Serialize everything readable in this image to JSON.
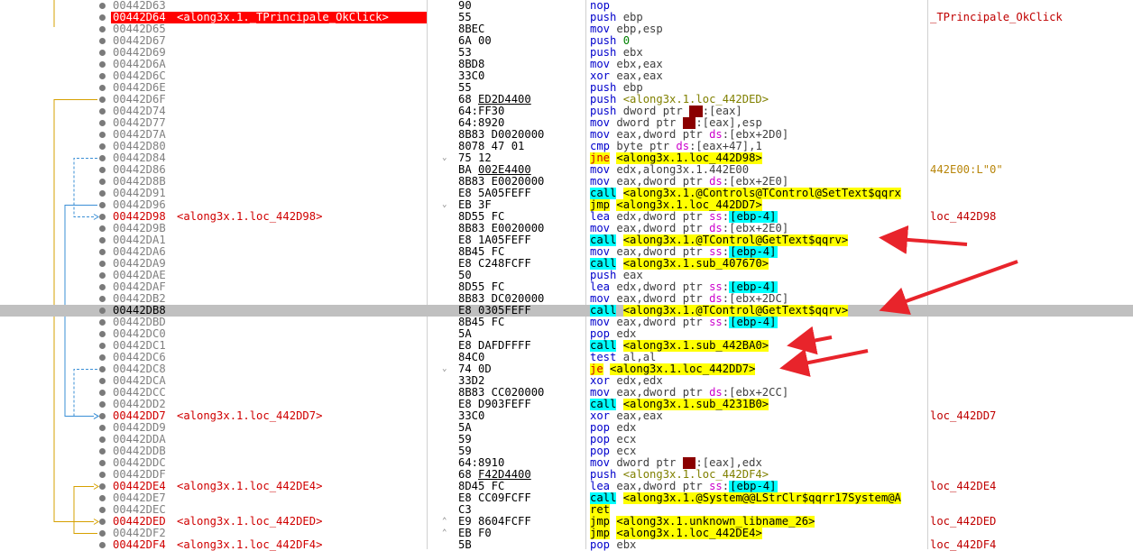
{
  "colors": {
    "arrow": "#e8242b",
    "label": "#d00000",
    "call_bg": "#00ffff",
    "jmp_bg": "#ffff00"
  },
  "rows": [
    {
      "addr": "00442D63",
      "label": "",
      "sym": "",
      "bytes": "90",
      "asm": [
        [
          "mn",
          "nop"
        ]
      ],
      "comment": ""
    },
    {
      "addr": "00442D64",
      "label": "<along3x.1._TPrincipale_OkClick>",
      "sym": "",
      "bytes": "55",
      "asm": [
        [
          "mn",
          "push "
        ],
        [
          "op",
          "ebp"
        ]
      ],
      "comment": "_TPrincipale_OkClick",
      "hl": true
    },
    {
      "addr": "00442D65",
      "label": "",
      "sym": "",
      "bytes": "8BEC",
      "asm": [
        [
          "mn",
          "mov "
        ],
        [
          "op",
          "ebp,esp"
        ]
      ],
      "comment": ""
    },
    {
      "addr": "00442D67",
      "label": "",
      "sym": "",
      "bytes": "6A 00",
      "asm": [
        [
          "mn",
          "push "
        ],
        [
          "imm",
          "0"
        ]
      ],
      "comment": ""
    },
    {
      "addr": "00442D69",
      "label": "",
      "sym": "",
      "bytes": "53",
      "asm": [
        [
          "mn",
          "push "
        ],
        [
          "op",
          "ebx"
        ]
      ],
      "comment": ""
    },
    {
      "addr": "00442D6A",
      "label": "",
      "sym": "",
      "bytes": "8BD8",
      "asm": [
        [
          "mn",
          "mov "
        ],
        [
          "op",
          "ebx,eax"
        ]
      ],
      "comment": ""
    },
    {
      "addr": "00442D6C",
      "label": "",
      "sym": "",
      "bytes": "33C0",
      "asm": [
        [
          "mn",
          "xor "
        ],
        [
          "op",
          "eax,eax"
        ]
      ],
      "comment": ""
    },
    {
      "addr": "00442D6E",
      "label": "",
      "sym": "",
      "bytes": "55",
      "asm": [
        [
          "mn",
          "push "
        ],
        [
          "op",
          "ebp"
        ]
      ],
      "comment": ""
    },
    {
      "addr": "00442D6F",
      "label": "",
      "sym": "",
      "bytes": "68 ED2D4400",
      "ubytes": "ED2D4400",
      "asm": [
        [
          "mn",
          "push "
        ],
        [
          "tgtp",
          "<along3x.1.loc_442DED>"
        ]
      ],
      "comment": ""
    },
    {
      "addr": "00442D74",
      "label": "",
      "sym": "",
      "bytes": "64:FF30",
      "asm": [
        [
          "mn",
          "push "
        ],
        [
          "op",
          "dword ptr "
        ],
        [
          "seg",
          "fs"
        ],
        [
          "op",
          ":[eax]"
        ]
      ],
      "comment": ""
    },
    {
      "addr": "00442D77",
      "label": "",
      "sym": "",
      "bytes": "64:8920",
      "asm": [
        [
          "mn",
          "mov "
        ],
        [
          "op",
          "dword ptr "
        ],
        [
          "seg",
          "fs"
        ],
        [
          "op",
          ":[eax],esp"
        ]
      ],
      "comment": ""
    },
    {
      "addr": "00442D7A",
      "label": "",
      "sym": "",
      "bytes": "8B83 D0020000",
      "asm": [
        [
          "mn",
          "mov "
        ],
        [
          "op",
          "eax,dword ptr "
        ],
        [
          "segds",
          "ds"
        ],
        [
          "op",
          ":[ebx+2D0]"
        ]
      ],
      "comment": ""
    },
    {
      "addr": "00442D80",
      "label": "",
      "sym": "",
      "bytes": "8078 47 01",
      "asm": [
        [
          "mn",
          "cmp "
        ],
        [
          "op",
          "byte ptr "
        ],
        [
          "segds",
          "ds"
        ],
        [
          "op",
          ":[eax+47],1"
        ]
      ],
      "comment": ""
    },
    {
      "addr": "00442D84",
      "label": "",
      "sym": "v",
      "bytes": "75 12",
      "asm": [
        [
          "jcc",
          "jne"
        ],
        [
          "op",
          " "
        ],
        [
          "tgt",
          "<along3x.1.loc_442D98>"
        ]
      ],
      "comment": ""
    },
    {
      "addr": "00442D86",
      "label": "",
      "sym": "",
      "bytes": "BA 002E4400",
      "ubytes": "002E4400",
      "asm": [
        [
          "mn",
          "mov "
        ],
        [
          "op",
          "edx,along3x.1.442E00"
        ]
      ],
      "comment": "442E00:L\"0\"",
      "cstr": true
    },
    {
      "addr": "00442D8B",
      "label": "",
      "sym": "",
      "bytes": "8B83 E0020000",
      "asm": [
        [
          "mn",
          "mov "
        ],
        [
          "op",
          "eax,dword ptr "
        ],
        [
          "segds",
          "ds"
        ],
        [
          "op",
          ":[ebx+2E0]"
        ]
      ],
      "comment": ""
    },
    {
      "addr": "00442D91",
      "label": "",
      "sym": "",
      "bytes": "E8 5A05FEFF",
      "asm": [
        [
          "call",
          "call"
        ],
        [
          "op",
          " "
        ],
        [
          "tgt",
          "<along3x.1.@Controls@TControl@SetText$qqrx"
        ]
      ],
      "comment": ""
    },
    {
      "addr": "00442D96",
      "label": "",
      "sym": "v",
      "bytes": "EB 3F",
      "asm": [
        [
          "jmp",
          "jmp"
        ],
        [
          "op",
          " "
        ],
        [
          "tgt",
          "<along3x.1.loc_442DD7>"
        ]
      ],
      "comment": ""
    },
    {
      "addr": "00442D98",
      "label": "<along3x.1.loc_442D98>",
      "sym": "",
      "bytes": "8D55 FC",
      "asm": [
        [
          "mn",
          "lea "
        ],
        [
          "op",
          "edx,dword ptr "
        ],
        [
          "segds",
          "ss"
        ],
        [
          "op",
          ":"
        ],
        [
          "memb",
          "[ebp-4]"
        ]
      ],
      "comment": "loc_442D98"
    },
    {
      "addr": "00442D9B",
      "label": "",
      "sym": "",
      "bytes": "8B83 E0020000",
      "asm": [
        [
          "mn",
          "mov "
        ],
        [
          "op",
          "eax,dword ptr "
        ],
        [
          "segds",
          "ds"
        ],
        [
          "op",
          ":[ebx+2E0]"
        ]
      ],
      "comment": ""
    },
    {
      "addr": "00442DA1",
      "label": "",
      "sym": "",
      "bytes": "E8 1A05FEFF",
      "asm": [
        [
          "call",
          "call"
        ],
        [
          "op",
          " "
        ],
        [
          "tgt",
          "<along3x.1.@TControl@GetText$qqrv>"
        ]
      ],
      "comment": ""
    },
    {
      "addr": "00442DA6",
      "label": "",
      "sym": "",
      "bytes": "8B45 FC",
      "asm": [
        [
          "mn",
          "mov "
        ],
        [
          "op",
          "eax,dword ptr "
        ],
        [
          "segds",
          "ss"
        ],
        [
          "op",
          ":"
        ],
        [
          "memb",
          "[ebp-4]"
        ]
      ],
      "comment": ""
    },
    {
      "addr": "00442DA9",
      "label": "",
      "sym": "",
      "bytes": "E8 C248FCFF",
      "asm": [
        [
          "call",
          "call"
        ],
        [
          "op",
          " "
        ],
        [
          "tgt",
          "<along3x.1.sub_407670>"
        ]
      ],
      "comment": ""
    },
    {
      "addr": "00442DAE",
      "label": "",
      "sym": "",
      "bytes": "50",
      "asm": [
        [
          "mn",
          "push "
        ],
        [
          "op",
          "eax"
        ]
      ],
      "comment": ""
    },
    {
      "addr": "00442DAF",
      "label": "",
      "sym": "",
      "bytes": "8D55 FC",
      "asm": [
        [
          "mn",
          "lea "
        ],
        [
          "op",
          "edx,dword ptr "
        ],
        [
          "segds",
          "ss"
        ],
        [
          "op",
          ":"
        ],
        [
          "memb",
          "[ebp-4]"
        ]
      ],
      "comment": ""
    },
    {
      "addr": "00442DB2",
      "label": "",
      "sym": "",
      "bytes": "8B83 DC020000",
      "asm": [
        [
          "mn",
          "mov "
        ],
        [
          "op",
          "eax,dword ptr "
        ],
        [
          "segds",
          "ds"
        ],
        [
          "op",
          ":[ebx+2DC]"
        ]
      ],
      "comment": ""
    },
    {
      "addr": "00442DB8",
      "label": "",
      "sym": "",
      "bytes": "E8 0305FEFF",
      "asm": [
        [
          "call",
          "call"
        ],
        [
          "op",
          " "
        ],
        [
          "tgt",
          "<along3x.1.@TControl@GetText$qqrv>"
        ]
      ],
      "comment": "",
      "cur": true
    },
    {
      "addr": "00442DBD",
      "label": "",
      "sym": "",
      "bytes": "8B45 FC",
      "asm": [
        [
          "mn",
          "mov "
        ],
        [
          "op",
          "eax,dword ptr "
        ],
        [
          "segds",
          "ss"
        ],
        [
          "op",
          ":"
        ],
        [
          "memb",
          "[ebp-4]"
        ]
      ],
      "comment": ""
    },
    {
      "addr": "00442DC0",
      "label": "",
      "sym": "",
      "bytes": "5A",
      "asm": [
        [
          "mn",
          "pop "
        ],
        [
          "op",
          "edx"
        ]
      ],
      "comment": ""
    },
    {
      "addr": "00442DC1",
      "label": "",
      "sym": "",
      "bytes": "E8 DAFDFFFF",
      "asm": [
        [
          "call",
          "call"
        ],
        [
          "op",
          " "
        ],
        [
          "tgt",
          "<along3x.1.sub_442BA0>"
        ]
      ],
      "comment": ""
    },
    {
      "addr": "00442DC6",
      "label": "",
      "sym": "",
      "bytes": "84C0",
      "asm": [
        [
          "mn",
          "test "
        ],
        [
          "op",
          "al,al"
        ]
      ],
      "comment": ""
    },
    {
      "addr": "00442DC8",
      "label": "",
      "sym": "v",
      "bytes": "74 0D",
      "asm": [
        [
          "jcc",
          "je"
        ],
        [
          "op",
          " "
        ],
        [
          "tgt",
          "<along3x.1.loc_442DD7>"
        ]
      ],
      "comment": ""
    },
    {
      "addr": "00442DCA",
      "label": "",
      "sym": "",
      "bytes": "33D2",
      "asm": [
        [
          "mn",
          "xor "
        ],
        [
          "op",
          "edx,edx"
        ]
      ],
      "comment": ""
    },
    {
      "addr": "00442DCC",
      "label": "",
      "sym": "",
      "bytes": "8B83 CC020000",
      "asm": [
        [
          "mn",
          "mov "
        ],
        [
          "op",
          "eax,dword ptr "
        ],
        [
          "segds",
          "ds"
        ],
        [
          "op",
          ":[ebx+2CC]"
        ]
      ],
      "comment": ""
    },
    {
      "addr": "00442DD2",
      "label": "",
      "sym": "",
      "bytes": "E8 D903FEFF",
      "asm": [
        [
          "call",
          "call"
        ],
        [
          "op",
          " "
        ],
        [
          "tgt",
          "<along3x.1.sub_4231B0>"
        ]
      ],
      "comment": ""
    },
    {
      "addr": "00442DD7",
      "label": "<along3x.1.loc_442DD7>",
      "sym": "",
      "bytes": "33C0",
      "asm": [
        [
          "mn",
          "xor "
        ],
        [
          "op",
          "eax,eax"
        ]
      ],
      "comment": "loc_442DD7"
    },
    {
      "addr": "00442DD9",
      "label": "",
      "sym": "",
      "bytes": "5A",
      "asm": [
        [
          "mn",
          "pop "
        ],
        [
          "op",
          "edx"
        ]
      ],
      "comment": ""
    },
    {
      "addr": "00442DDA",
      "label": "",
      "sym": "",
      "bytes": "59",
      "asm": [
        [
          "mn",
          "pop "
        ],
        [
          "op",
          "ecx"
        ]
      ],
      "comment": ""
    },
    {
      "addr": "00442DDB",
      "label": "",
      "sym": "",
      "bytes": "59",
      "asm": [
        [
          "mn",
          "pop "
        ],
        [
          "op",
          "ecx"
        ]
      ],
      "comment": ""
    },
    {
      "addr": "00442DDC",
      "label": "",
      "sym": "",
      "bytes": "64:8910",
      "asm": [
        [
          "mn",
          "mov "
        ],
        [
          "op",
          "dword ptr "
        ],
        [
          "seg",
          "fs"
        ],
        [
          "op",
          ":[eax],edx"
        ]
      ],
      "comment": ""
    },
    {
      "addr": "00442DDF",
      "label": "",
      "sym": "",
      "bytes": "68 F42D4400",
      "ubytes": "F42D4400",
      "asm": [
        [
          "mn",
          "push "
        ],
        [
          "tgtp",
          "<along3x.1.loc_442DF4>"
        ]
      ],
      "comment": ""
    },
    {
      "addr": "00442DE4",
      "label": "<along3x.1.loc_442DE4>",
      "sym": "",
      "bytes": "8D45 FC",
      "asm": [
        [
          "mn",
          "lea "
        ],
        [
          "op",
          "eax,dword ptr "
        ],
        [
          "segds",
          "ss"
        ],
        [
          "op",
          ":"
        ],
        [
          "memb",
          "[ebp-4]"
        ]
      ],
      "comment": "loc_442DE4"
    },
    {
      "addr": "00442DE7",
      "label": "",
      "sym": "",
      "bytes": "E8 CC09FCFF",
      "asm": [
        [
          "call",
          "call"
        ],
        [
          "op",
          " "
        ],
        [
          "tgt",
          "<along3x.1.@System@@LStrClr$qqrr17System@A"
        ]
      ],
      "comment": ""
    },
    {
      "addr": "00442DEC",
      "label": "",
      "sym": "",
      "bytes": "C3",
      "asm": [
        [
          "jmp",
          "ret"
        ]
      ],
      "comment": ""
    },
    {
      "addr": "00442DED",
      "label": "<along3x.1.loc_442DED>",
      "sym": "^",
      "bytes": "E9 8604FCFF",
      "asm": [
        [
          "jmp",
          "jmp"
        ],
        [
          "op",
          " "
        ],
        [
          "tgt",
          "<along3x.1.unknown_libname_26>"
        ]
      ],
      "comment": "loc_442DED"
    },
    {
      "addr": "00442DF2",
      "label": "",
      "sym": "^",
      "bytes": "EB F0",
      "asm": [
        [
          "jmp",
          "jmp"
        ],
        [
          "op",
          " "
        ],
        [
          "tgt",
          "<along3x.1.loc_442DE4>"
        ]
      ],
      "comment": ""
    },
    {
      "addr": "00442DF4",
      "label": "<along3x.1.loc_442DF4>",
      "sym": "",
      "bytes": "5B",
      "asm": [
        [
          "mn",
          "pop "
        ],
        [
          "op",
          "ebx"
        ]
      ],
      "comment": "loc_442DF4"
    }
  ]
}
